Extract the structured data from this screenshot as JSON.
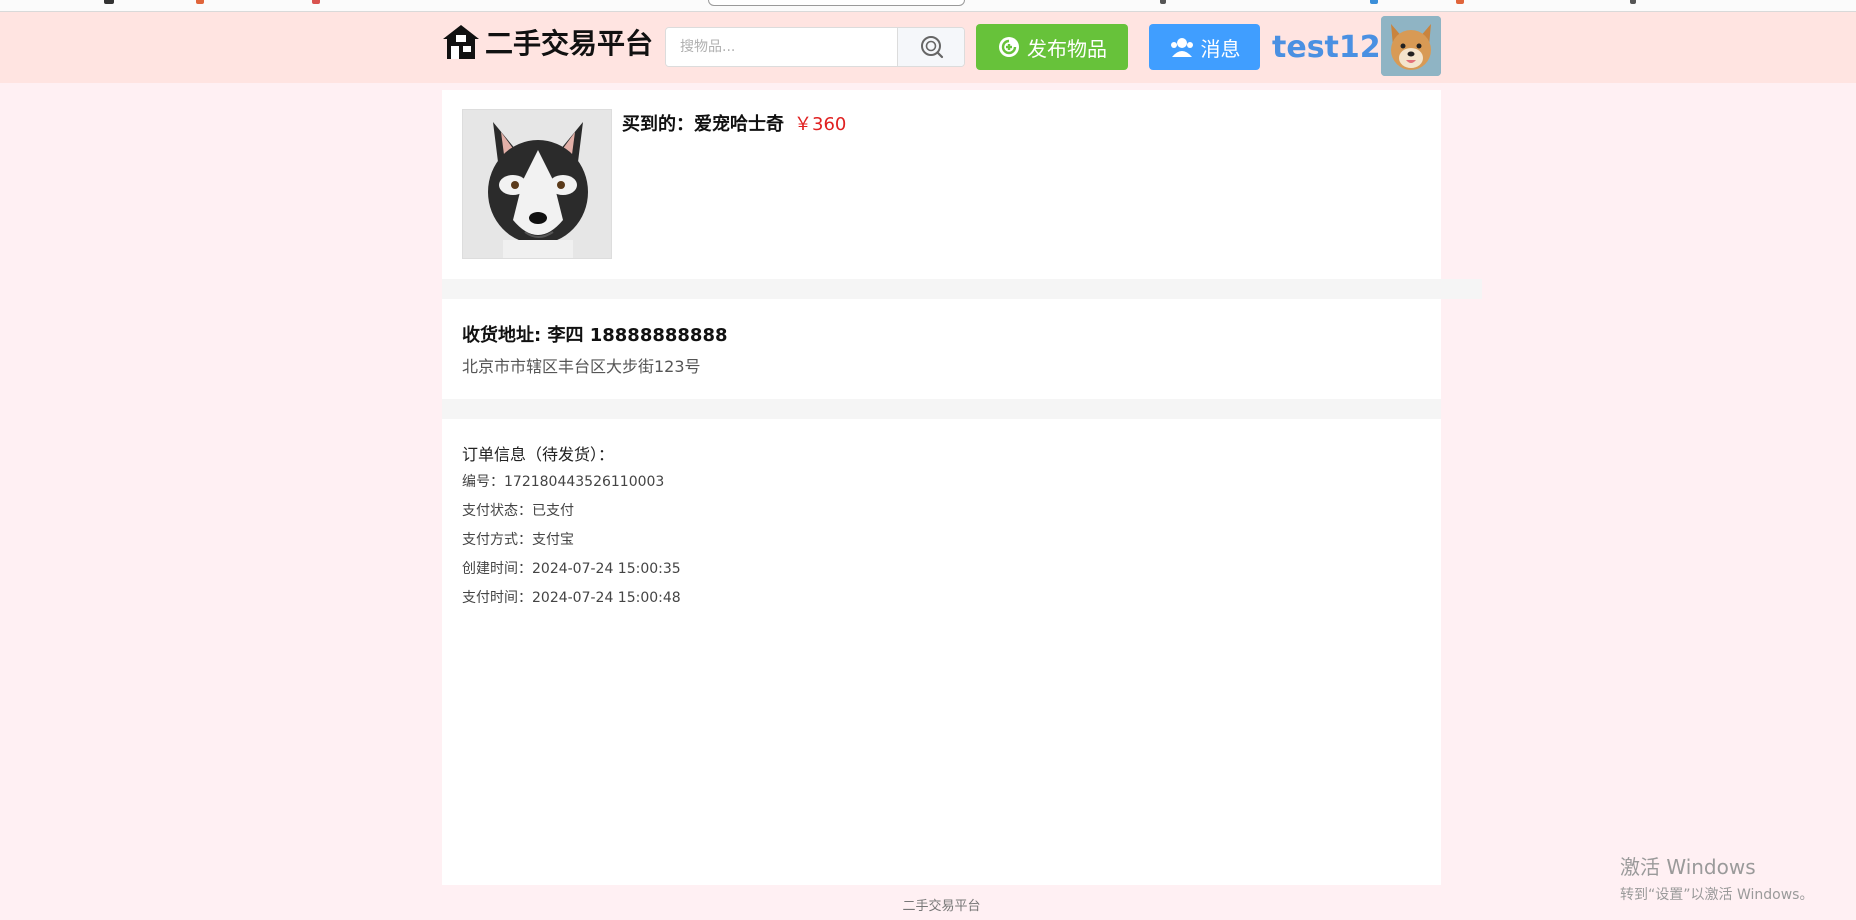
{
  "header": {
    "logo_text": "二手交易平台",
    "search_placeholder": "搜物品...",
    "publish_label": "发布物品",
    "message_label": "消息",
    "username": "test123"
  },
  "goods": {
    "title": "买到的：爱宠哈士奇",
    "price": "￥360"
  },
  "address": {
    "heading": "收货地址: 李四 18888888888",
    "line": "北京市市辖区丰台区大步街123号"
  },
  "order": {
    "title": "订单信息（待发货）：",
    "rows": [
      "编号：172180443526110003",
      "支付状态：已支付",
      "支付方式：支付宝",
      "创建时间：2024-07-24 15:00:35",
      "支付时间：2024-07-24 15:00:48"
    ]
  },
  "footer": {
    "text": "二手交易平台"
  },
  "watermark": {
    "line1": "激活 Windows",
    "line2": "转到“设置”以激活 Windows。"
  },
  "colors": {
    "header_bg": "#ffe4e1",
    "page_bg": "#fff0f3",
    "publish_green": "#67c23a",
    "message_blue": "#409eff",
    "price_red": "#e02020",
    "username_blue": "#4a90e2"
  }
}
